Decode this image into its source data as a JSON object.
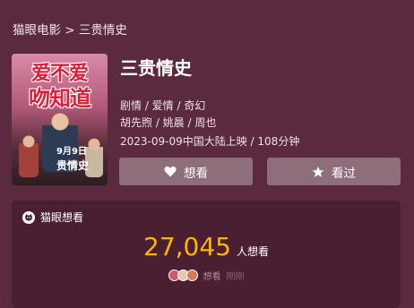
{
  "breadcrumb": {
    "home": "猫眼电影",
    "separator": ">",
    "current": "三贵情史"
  },
  "poster": {
    "title_line1": "爱不爱",
    "title_line2": "吻知道",
    "date": "9月9日",
    "subtitle": "贵情史"
  },
  "movie": {
    "title": "三贵情史",
    "genres": "剧情 / 爱情 / 奇幻",
    "cast": "胡先煦 / 姚晨 / 周也",
    "release": "2023-09-09中国大陆上映 / 108分钟"
  },
  "actions": {
    "want_label": "想看",
    "seen_label": "看过",
    "want_icon": "heart-icon",
    "seen_icon": "star-icon"
  },
  "want_stats": {
    "header": "猫眼想看",
    "count": "27,045",
    "count_label": "人想看",
    "recent_label": "想看",
    "recent_time": "刚刚",
    "count_color": "#ffb400",
    "avatar_colors": [
      "#c85a6a",
      "#e0c9b0",
      "#d87a5a"
    ]
  },
  "colors": {
    "background": "#5b2a3e",
    "card": "#4a1f31",
    "button": "rgba(255,255,255,0.32)"
  }
}
